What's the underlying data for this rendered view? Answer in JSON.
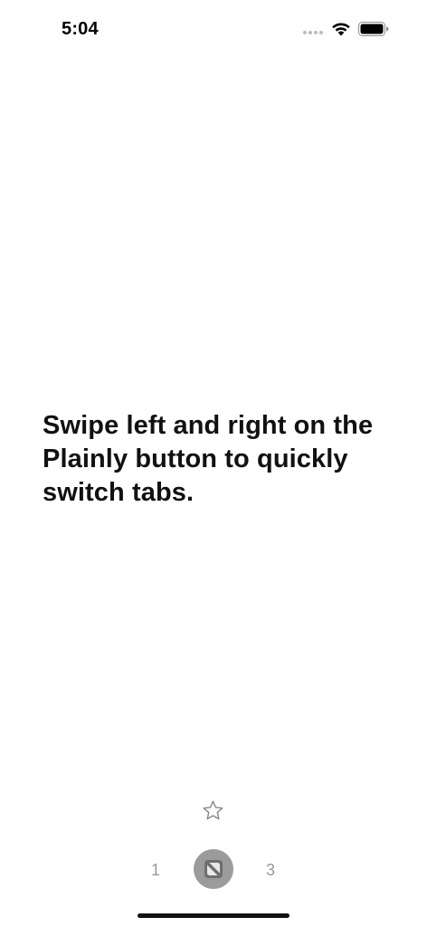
{
  "status_bar": {
    "time": "5:04",
    "icons": [
      "signal-dots-icon",
      "wifi-icon",
      "battery-icon"
    ]
  },
  "main": {
    "message": "Swipe left and right on the Plainly button to quickly switch tabs."
  },
  "favorite": {
    "icon": "star-outline-icon"
  },
  "tab_bar": {
    "left_tab": "1",
    "right_tab": "3",
    "center_icon": "plainly-logo-icon",
    "colors": {
      "button_bg": "#9b9b9b",
      "tab_number": "#9a9a9a"
    }
  }
}
